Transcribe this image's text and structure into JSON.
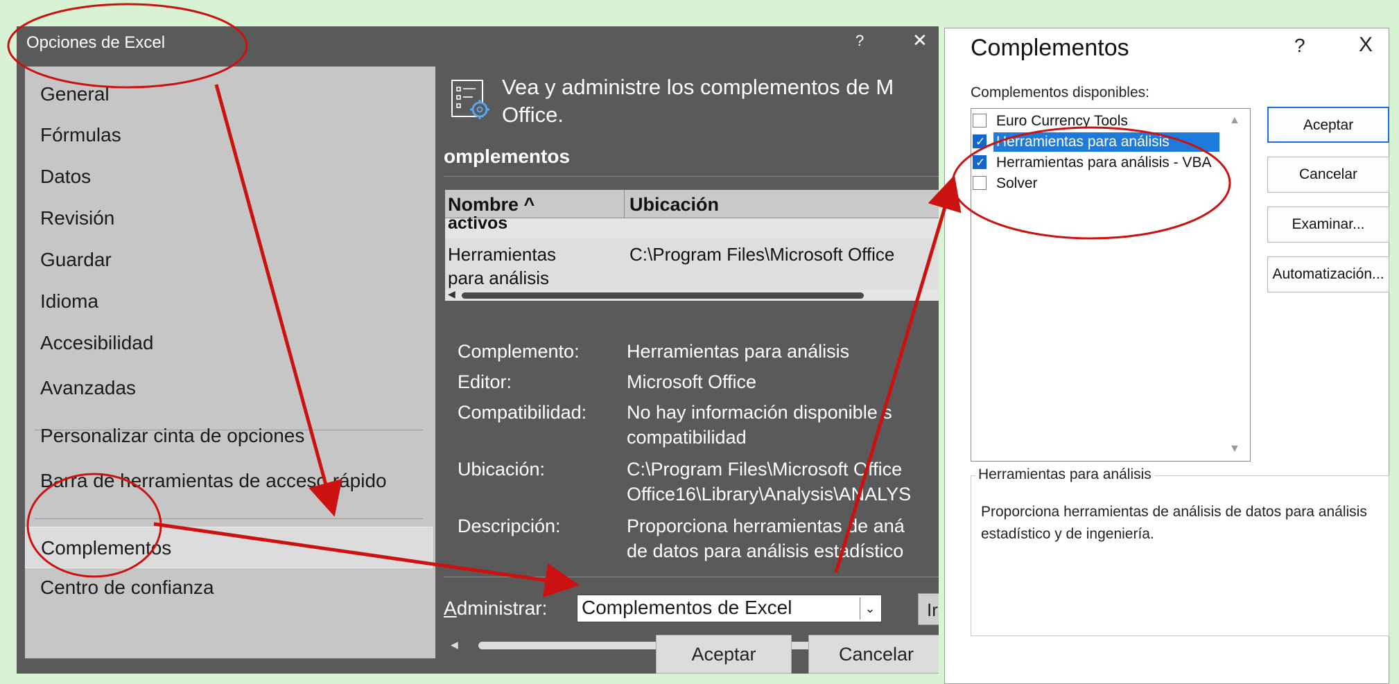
{
  "excel_options": {
    "title": "Opciones de Excel",
    "help": "?",
    "close": "✕",
    "sidebar": {
      "items": [
        {
          "label": "General"
        },
        {
          "label": "Fórmulas"
        },
        {
          "label": "Datos"
        },
        {
          "label": "Revisión"
        },
        {
          "label": "Guardar"
        },
        {
          "label": "Idioma"
        },
        {
          "label": "Accesibilidad"
        },
        {
          "label": "Avanzadas"
        },
        {
          "label": "Personalizar cinta de opciones"
        },
        {
          "label": "Barra de herramientas de acceso rápido"
        },
        {
          "label": "Complementos",
          "selected": true
        },
        {
          "label": "Centro de confianza"
        }
      ]
    },
    "main": {
      "header_line1": "Vea y administre los complementos de M",
      "header_line2": "Office.",
      "section_title": "omplementos",
      "table": {
        "col_name": "Nombre ^",
        "col_location": "Ubicación",
        "group": "activos",
        "row": {
          "name_line1": "Herramientas",
          "name_line2": "para análisis",
          "location": "C:\\Program Files\\Microsoft Office"
        }
      },
      "details": {
        "addin_label": "Complemento:",
        "addin_value": "Herramientas para análisis",
        "publisher_label": "Editor:",
        "publisher_value": "Microsoft Office",
        "compat_label": "Compatibilidad:",
        "compat_value_line1": "No hay información disponible s",
        "compat_value_line2": "compatibilidad",
        "location_label": "Ubicación:",
        "location_value_line1": "C:\\Program Files\\Microsoft Office",
        "location_value_line2": "Office16\\Library\\Analysis\\ANALYS",
        "description_label": "Descripción:",
        "description_value_line1": "Proporciona herramientas de aná",
        "description_value_line2": "de datos para análisis estadístico"
      },
      "manage": {
        "label_first": "A",
        "label_rest": "dministrar:",
        "value": "Complementos de Excel",
        "go_label": "Ir..."
      }
    },
    "ok_label": "Aceptar",
    "cancel_label": "Cancelar"
  },
  "addins_dialog": {
    "title": "Complementos",
    "help": "?",
    "close": "X",
    "available_label": "Complementos disponibles:",
    "items": [
      {
        "label": "Euro Currency Tools",
        "checked": false
      },
      {
        "label": "Herramientas para análisis",
        "checked": true,
        "selected": true
      },
      {
        "label": "Herramientas para análisis - VBA",
        "checked": true
      },
      {
        "label": "Solver",
        "checked": false
      }
    ],
    "buttons": {
      "ok": "Aceptar",
      "cancel": "Cancelar",
      "browse": "Examinar...",
      "automation": "Automatización..."
    },
    "description_title": "Herramientas para análisis",
    "description_text": "Proporciona herramientas de análisis de datos para análisis estadístico y de ingeniería."
  },
  "colors": {
    "annotation": "#cc1111",
    "selection": "#1e7bdc",
    "options_bg": "#5a5a5a",
    "sidebar_bg": "#c6c6c6",
    "page_bg": "#d8f2d4"
  }
}
